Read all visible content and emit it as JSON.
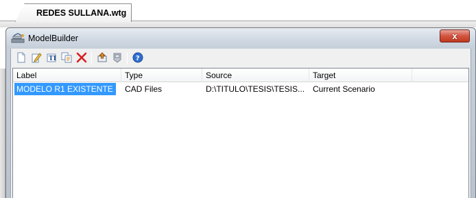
{
  "document_tab": {
    "title": "REDES SULLANA.wtg"
  },
  "window": {
    "title": "ModelBuilder",
    "icon": "modelbuilder-icon",
    "close_label": "x"
  },
  "toolbar": {
    "buttons": [
      {
        "name": "new",
        "icon": "new-document-icon"
      },
      {
        "name": "edit",
        "icon": "edit-icon"
      },
      {
        "name": "rename",
        "icon": "rename-icon"
      },
      {
        "name": "duplicate",
        "icon": "duplicate-icon"
      },
      {
        "name": "delete",
        "icon": "delete-icon"
      },
      {
        "name": "build",
        "icon": "build-model-icon"
      },
      {
        "name": "sync",
        "icon": "sync-out-icon"
      },
      {
        "name": "help",
        "icon": "help-icon"
      }
    ]
  },
  "list": {
    "columns": [
      "Label",
      "Type",
      "Source",
      "Target"
    ],
    "rows": [
      {
        "label": "MODELO R1 EXISTENTE",
        "type": "CAD Files",
        "source": "D:\\TITULO\\TESIS\\TESIS...",
        "target": "Current Scenario",
        "selected": true
      }
    ]
  },
  "colors": {
    "selection": "#3399ff",
    "close_button": "#c8452f",
    "title_bar": "#d4dce6"
  }
}
